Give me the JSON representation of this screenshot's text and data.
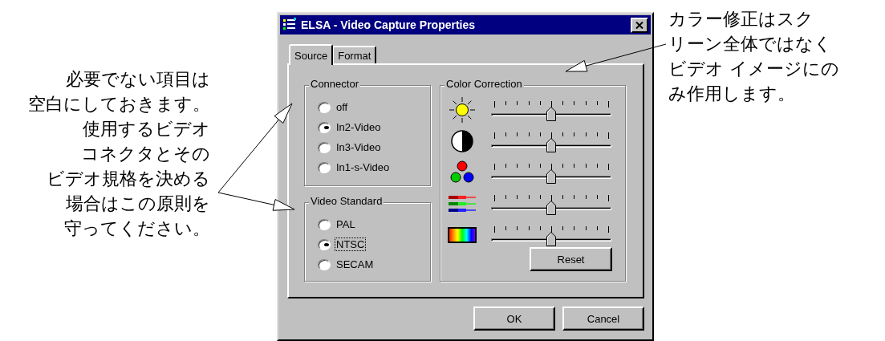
{
  "notes": [
    {
      "lines": [
        "必要でない項目は",
        "空白にしておきます。",
        "使用するビデオ",
        "コネクタとその",
        "ビデオ規格を決める",
        "場合はこの原則を",
        "守ってください。"
      ]
    },
    {
      "lines": [
        "カラー修正はスク",
        "リーン全体ではなく",
        "ビデオ イメージにの",
        "み作用します。"
      ]
    }
  ],
  "dialog": {
    "title": "ELSA - Video Capture Properties",
    "tabs": [
      {
        "label": "Source",
        "selected": true
      },
      {
        "label": "Format",
        "selected": false
      }
    ],
    "connector": {
      "title": "Connector",
      "options": [
        {
          "label": "off",
          "selected": false,
          "focused": false
        },
        {
          "label": "In2-Video",
          "selected": true,
          "focused": false
        },
        {
          "label": "In3-Video",
          "selected": false,
          "focused": false
        },
        {
          "label": "In1-s-Video",
          "selected": false,
          "focused": false
        }
      ]
    },
    "video_standard": {
      "title": "Video Standard",
      "options": [
        {
          "label": "PAL",
          "selected": false,
          "focused": false
        },
        {
          "label": "NTSC",
          "selected": true,
          "focused": true
        },
        {
          "label": "SECAM",
          "selected": false,
          "focused": false
        }
      ]
    },
    "color_correction": {
      "title": "Color Correction",
      "sliders": [
        {
          "kind": "brightness",
          "level": 0.5
        },
        {
          "kind": "contrast",
          "level": 0.5
        },
        {
          "kind": "saturation",
          "level": 0.5
        },
        {
          "kind": "balance",
          "level": 0.5
        },
        {
          "kind": "hue",
          "level": 0.5
        }
      ],
      "reset_button": "Reset"
    },
    "buttons": [
      "OK",
      "Cancel"
    ]
  }
}
